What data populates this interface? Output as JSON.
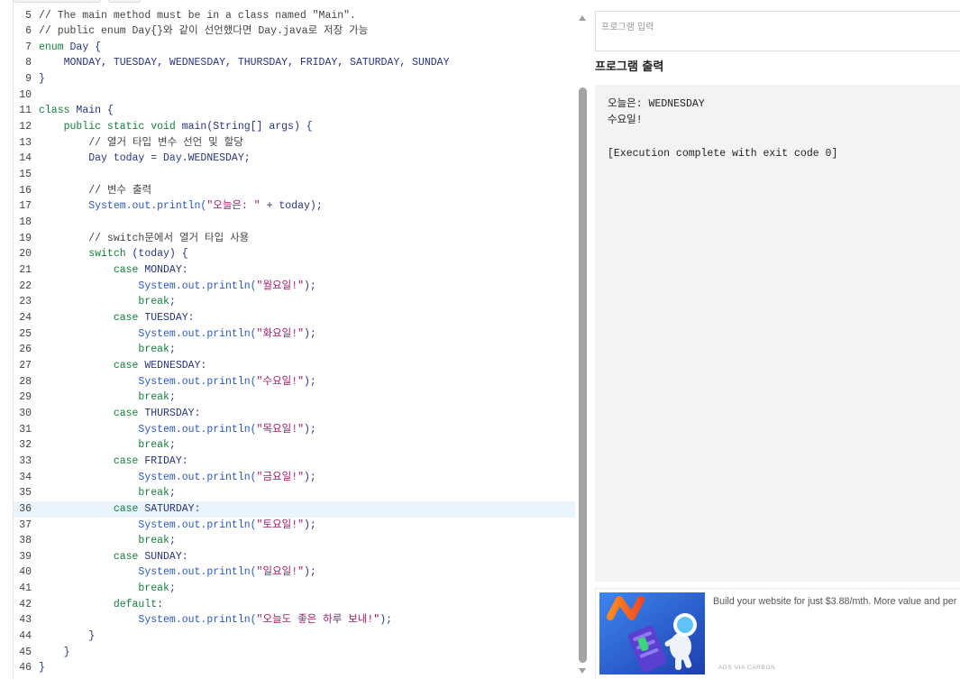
{
  "editor": {
    "active_line": 36,
    "lines": [
      {
        "n": 5,
        "tokens": [
          {
            "t": "comment",
            "v": "// The main method must be in a class named \"Main\"."
          }
        ]
      },
      {
        "n": 6,
        "tokens": [
          {
            "t": "comment",
            "v": "// public enum Day{}와 같이 선언했다면 Day.java로 저장 가능"
          }
        ]
      },
      {
        "n": 7,
        "tokens": [
          {
            "t": "keyword",
            "v": "enum"
          },
          {
            "t": "ident",
            "v": " Day {"
          }
        ]
      },
      {
        "n": 8,
        "tokens": [
          {
            "t": "ident",
            "v": "    MONDAY, TUESDAY, WEDNESDAY, THURSDAY, FRIDAY, SATURDAY, SUNDAY"
          }
        ]
      },
      {
        "n": 9,
        "tokens": [
          {
            "t": "ident",
            "v": "}"
          }
        ]
      },
      {
        "n": 10,
        "tokens": []
      },
      {
        "n": 11,
        "tokens": [
          {
            "t": "keyword",
            "v": "class"
          },
          {
            "t": "ident",
            "v": " Main {"
          }
        ]
      },
      {
        "n": 12,
        "tokens": [
          {
            "t": "keyword",
            "v": "    public static void"
          },
          {
            "t": "ident",
            "v": " main(String[] args) {"
          }
        ]
      },
      {
        "n": 13,
        "tokens": [
          {
            "t": "comment",
            "v": "        // 열거 타입 변수 선언 및 할당"
          }
        ]
      },
      {
        "n": 14,
        "tokens": [
          {
            "t": "ident",
            "v": "        Day today = Day.WEDNESDAY;"
          }
        ]
      },
      {
        "n": 15,
        "tokens": []
      },
      {
        "n": 16,
        "tokens": [
          {
            "t": "comment",
            "v": "        // 변수 출력"
          }
        ]
      },
      {
        "n": 17,
        "tokens": [
          {
            "t": "call",
            "v": "        System.out.println("
          },
          {
            "t": "string",
            "v": "\"오늘은: \""
          },
          {
            "t": "ident",
            "v": " + today);"
          }
        ]
      },
      {
        "n": 18,
        "tokens": []
      },
      {
        "n": 19,
        "tokens": [
          {
            "t": "comment",
            "v": "        // switch문에서 열거 타입 사용"
          }
        ]
      },
      {
        "n": 20,
        "tokens": [
          {
            "t": "keyword",
            "v": "        switch"
          },
          {
            "t": "ident",
            "v": " (today) {"
          }
        ]
      },
      {
        "n": 21,
        "tokens": [
          {
            "t": "keyword",
            "v": "            case"
          },
          {
            "t": "ident",
            "v": " MONDAY:"
          }
        ]
      },
      {
        "n": 22,
        "tokens": [
          {
            "t": "call",
            "v": "                System.out.println("
          },
          {
            "t": "string",
            "v": "\"월요일!\""
          },
          {
            "t": "ident",
            "v": ");"
          }
        ]
      },
      {
        "n": 23,
        "tokens": [
          {
            "t": "keyword",
            "v": "                break"
          },
          {
            "t": "ident",
            "v": ";"
          }
        ]
      },
      {
        "n": 24,
        "tokens": [
          {
            "t": "keyword",
            "v": "            case"
          },
          {
            "t": "ident",
            "v": " TUESDAY:"
          }
        ]
      },
      {
        "n": 25,
        "tokens": [
          {
            "t": "call",
            "v": "                System.out.println("
          },
          {
            "t": "string",
            "v": "\"화요일!\""
          },
          {
            "t": "ident",
            "v": ");"
          }
        ]
      },
      {
        "n": 26,
        "tokens": [
          {
            "t": "keyword",
            "v": "                break"
          },
          {
            "t": "ident",
            "v": ";"
          }
        ]
      },
      {
        "n": 27,
        "tokens": [
          {
            "t": "keyword",
            "v": "            case"
          },
          {
            "t": "ident",
            "v": " WEDNESDAY:"
          }
        ]
      },
      {
        "n": 28,
        "tokens": [
          {
            "t": "call",
            "v": "                System.out.println("
          },
          {
            "t": "string",
            "v": "\"수요일!\""
          },
          {
            "t": "ident",
            "v": ");"
          }
        ]
      },
      {
        "n": 29,
        "tokens": [
          {
            "t": "keyword",
            "v": "                break"
          },
          {
            "t": "ident",
            "v": ";"
          }
        ]
      },
      {
        "n": 30,
        "tokens": [
          {
            "t": "keyword",
            "v": "            case"
          },
          {
            "t": "ident",
            "v": " THURSDAY:"
          }
        ]
      },
      {
        "n": 31,
        "tokens": [
          {
            "t": "call",
            "v": "                System.out.println("
          },
          {
            "t": "string",
            "v": "\"목요일!\""
          },
          {
            "t": "ident",
            "v": ");"
          }
        ]
      },
      {
        "n": 32,
        "tokens": [
          {
            "t": "keyword",
            "v": "                break"
          },
          {
            "t": "ident",
            "v": ";"
          }
        ]
      },
      {
        "n": 33,
        "tokens": [
          {
            "t": "keyword",
            "v": "            case"
          },
          {
            "t": "ident",
            "v": " FRIDAY:"
          }
        ]
      },
      {
        "n": 34,
        "tokens": [
          {
            "t": "call",
            "v": "                System.out.println("
          },
          {
            "t": "string",
            "v": "\"금요일!\""
          },
          {
            "t": "ident",
            "v": ");"
          }
        ]
      },
      {
        "n": 35,
        "tokens": [
          {
            "t": "keyword",
            "v": "                break"
          },
          {
            "t": "ident",
            "v": ";"
          }
        ]
      },
      {
        "n": 36,
        "tokens": [
          {
            "t": "keyword",
            "v": "            case"
          },
          {
            "t": "ident",
            "v": " SATURDAY:"
          }
        ]
      },
      {
        "n": 37,
        "tokens": [
          {
            "t": "call",
            "v": "                System.out.println("
          },
          {
            "t": "string",
            "v": "\"토요일!\""
          },
          {
            "t": "ident",
            "v": ");"
          }
        ]
      },
      {
        "n": 38,
        "tokens": [
          {
            "t": "keyword",
            "v": "                break"
          },
          {
            "t": "ident",
            "v": ";"
          }
        ]
      },
      {
        "n": 39,
        "tokens": [
          {
            "t": "keyword",
            "v": "            case"
          },
          {
            "t": "ident",
            "v": " SUNDAY:"
          }
        ]
      },
      {
        "n": 40,
        "tokens": [
          {
            "t": "call",
            "v": "                System.out.println("
          },
          {
            "t": "string",
            "v": "\"일요일!\""
          },
          {
            "t": "ident",
            "v": ");"
          }
        ]
      },
      {
        "n": 41,
        "tokens": [
          {
            "t": "keyword",
            "v": "                break"
          },
          {
            "t": "ident",
            "v": ";"
          }
        ]
      },
      {
        "n": 42,
        "tokens": [
          {
            "t": "keyword",
            "v": "            default"
          },
          {
            "t": "ident",
            "v": ":"
          }
        ]
      },
      {
        "n": 43,
        "tokens": [
          {
            "t": "call",
            "v": "                System.out.println("
          },
          {
            "t": "string",
            "v": "\"오늘도 좋은 하루 보내!\""
          },
          {
            "t": "ident",
            "v": ");"
          }
        ]
      },
      {
        "n": 44,
        "tokens": [
          {
            "t": "ident",
            "v": "        }"
          }
        ]
      },
      {
        "n": 45,
        "tokens": [
          {
            "t": "ident",
            "v": "    }"
          }
        ]
      },
      {
        "n": 46,
        "tokens": [
          {
            "t": "ident",
            "v": "}"
          }
        ]
      }
    ]
  },
  "input": {
    "placeholder": "프로그램 입력"
  },
  "output": {
    "heading": "프로그램 출력",
    "lines": [
      "오늘은: WEDNESDAY",
      "수요일!",
      "",
      "[Execution complete with exit code 0]"
    ]
  },
  "ad": {
    "image": "namecheap-astronaut-ad-image",
    "text": "Build your website for just $3.88/mth. More value and per",
    "via": "ADS VIA CARBON"
  },
  "icons": {
    "scroll_up": "scroll-up-arrow-icon",
    "scroll_down": "scroll-down-arrow-icon"
  },
  "colors": {
    "keyword": "#16803c",
    "ident": "#27357e",
    "call": "#2b59c3",
    "string": "#a3196a",
    "comment": "#444444",
    "line_number": "#444444",
    "active_line": "#eaf4fd",
    "output_bg": "#f3f3f3",
    "scroll_thumb": "#a4a4a4"
  }
}
